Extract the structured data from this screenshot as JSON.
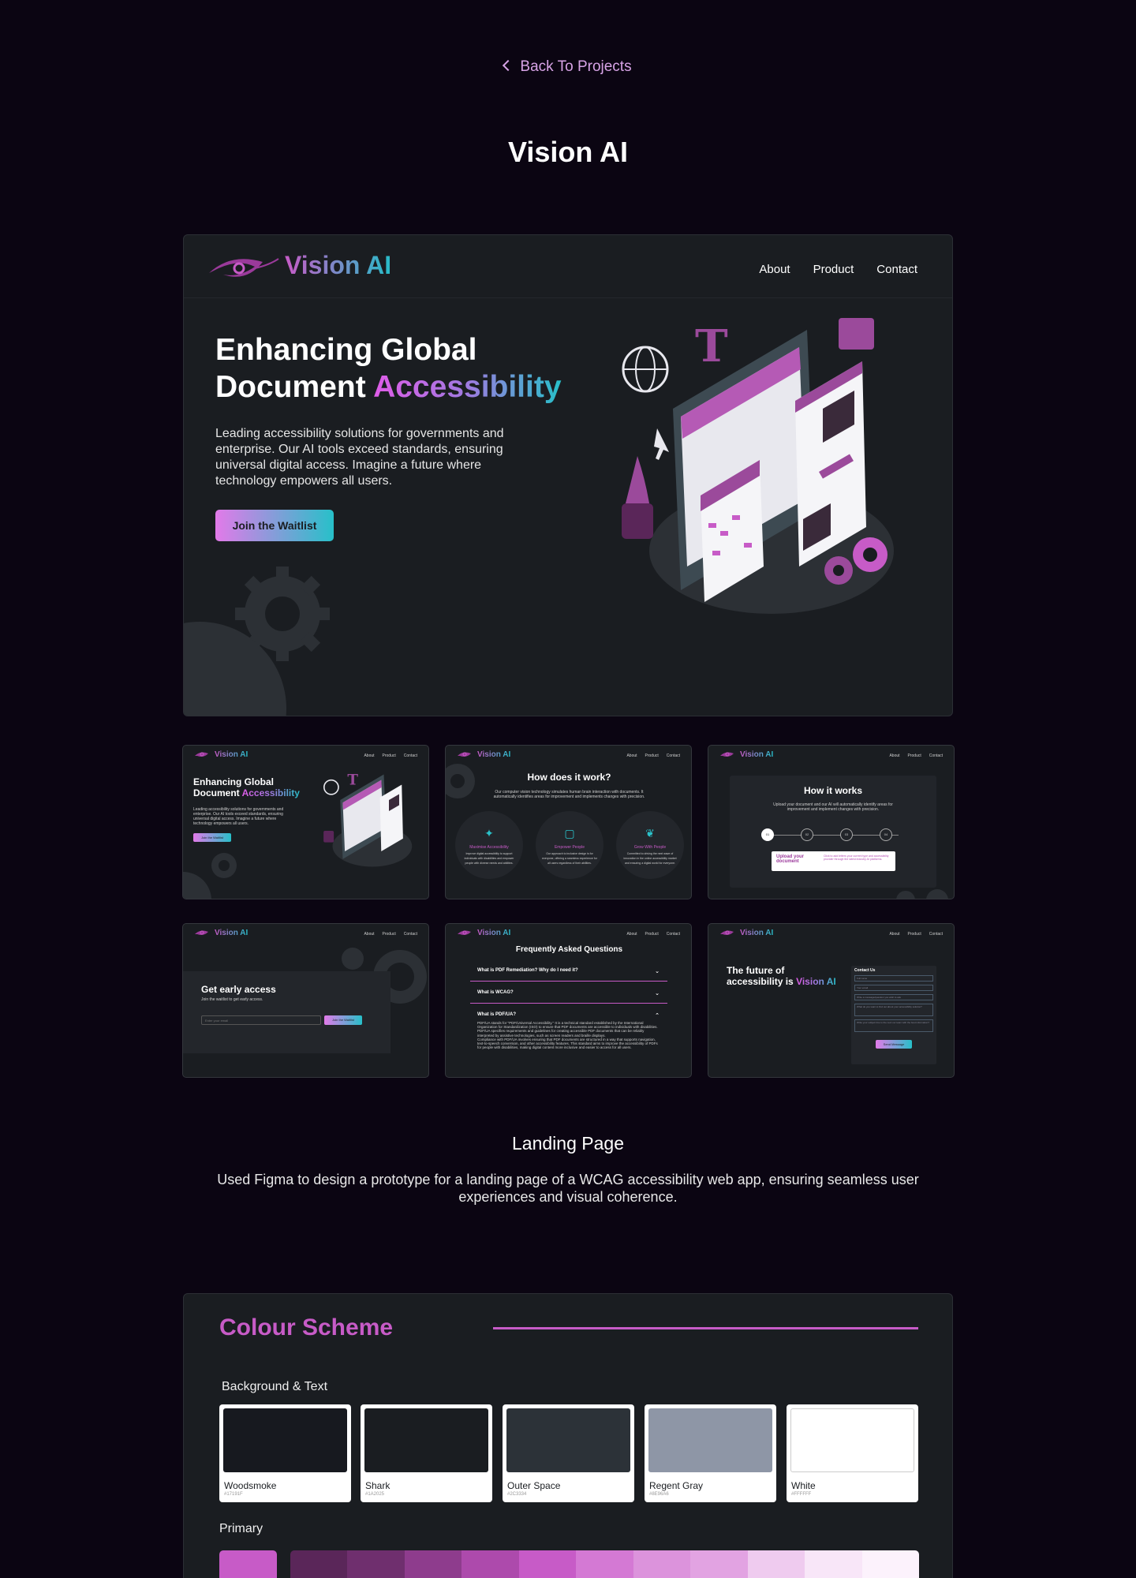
{
  "nav": {
    "back_label": "Back To Projects"
  },
  "page": {
    "title": "Vision AI"
  },
  "hero": {
    "logo": "Vision AI",
    "nav_links": [
      "About",
      "Product",
      "Contact"
    ],
    "heading_line1": "Enhancing Global",
    "heading_line2_prefix": "Document ",
    "heading_highlight": "Accessibility",
    "body": "Leading accessibility solutions for governments and enterprise. Our AI tools exceed standards, ensuring universal digital access. Imagine a future where technology empowers all users.",
    "cta": "Join the Waitlist"
  },
  "thumbs": {
    "logo": "Vision AI",
    "links": [
      "About",
      "Product",
      "Contact"
    ],
    "t1": {
      "h_line1": "Enhancing Global",
      "h_prefix": "Document ",
      "h_highlight": "Accessibility",
      "body": "Leading accessibility solutions for governments and enterprise. Our AI tools exceed standards, ensuring universal digital access. Imagine a future where technology empowers all users.",
      "cta": "Join the Waitlist"
    },
    "t2": {
      "title": "How does it work?",
      "sub": "Our computer vision technology simulates human brain interaction with documents. It automatically identifies areas for improvement and implements changes with precision.",
      "items": [
        {
          "label": "Maximise Accessibility",
          "text": "Improve digital accessibility to support individuals with disabilities and empower people with diverse needs and abilities."
        },
        {
          "label": "Empower People",
          "text": "Our approach to inclusive design is for everyone, offering a seamless experience for all users regardless of their abilities."
        },
        {
          "label": "Grow With People",
          "text": "Committed to driving the next wave of innovation in the online accessibility market and ensuring a digital world for everyone."
        }
      ]
    },
    "t3": {
      "title": "How it works",
      "sub": "Upload your document and our AI will automatically identify areas for improvement and implement changes with precision.",
      "steps": [
        "01",
        "02",
        "03",
        "04"
      ],
      "card_title": "Upload your document",
      "card_text": "Click to add letters your current type and accessibility provider through the latest industry AI platforms."
    },
    "t4": {
      "title": "Get early access",
      "sub": "Join the waitlist to get early access.",
      "placeholder": "Enter your email",
      "cta": "Join the Waitlist"
    },
    "t5": {
      "title": "Frequently Asked Questions",
      "q1": "What is PDF Remediation? Why do I need it?",
      "q2": "What is WCAG?",
      "q3": "What is PDF/UA?",
      "a3": "PDF/UA stands for \"PDF/Universal Accessibility.\" It is a technical standard established by the International Organization for Standardization (ISO) to ensure that PDF documents are accessible to individuals with disabilities. PDF/UA specifies requirements and guidelines for creating accessible PDF documents that can be reliably interpreted by assistive technologies, such as screen readers and braille displays.",
      "a3b": "Compliance with PDF/UA involves ensuring that PDF documents are structured in a way that supports navigation, text-to-speech conversion, and other accessibility features. This standard aims to improve the accessibility of PDFs for people with disabilities, making digital content more inclusive and easier to access for all users."
    },
    "t6": {
      "h_line1": "The future of",
      "h_prefix": "accessibility is ",
      "h_highlight": "Vision AI",
      "form_title": "Contact Us",
      "fields": [
        "Full name",
        "Your email",
        "Write a message/question you wish to ask",
        "What do you want to find out about your accessibility solution?",
        "Write your subject line to the next our team with the best information?"
      ],
      "cta": "Send Message"
    }
  },
  "landing": {
    "title": "Landing Page",
    "description": "Used Figma to design a prototype for a landing page of a WCAG accessibility web app, ensuring seamless user experiences and visual coherence."
  },
  "scheme": {
    "title": "Colour Scheme",
    "bg_text_label": "Background & Text",
    "swatches": [
      {
        "name": "Woodsmoke",
        "hex": "#17191F",
        "color": "#17191f"
      },
      {
        "name": "Shark",
        "hex": "#1A2025",
        "color": "#1a1d21"
      },
      {
        "name": "Outer Space",
        "hex": "#2C3334",
        "color": "#2c3238"
      },
      {
        "name": "Regent Gray",
        "hex": "#8E96A6",
        "color": "#8e96a6"
      },
      {
        "name": "White",
        "hex": "#FFFFFF",
        "color": "#ffffff"
      }
    ],
    "primary_label": "Primary",
    "primary_color": "#c75bc7",
    "ramp": [
      "#5a2659",
      "#6f2f6e",
      "#8e3c8d",
      "#ad4aac",
      "#c75bc7",
      "#d479d4",
      "#dc93dc",
      "#e2a3e2",
      "#efcbef",
      "#f8e6f8",
      "#fcf2fc"
    ]
  },
  "colors": {
    "background": "#0b0512",
    "card": "#1a1d21",
    "accent": "#c75bc7",
    "teal": "#27bcc8"
  }
}
